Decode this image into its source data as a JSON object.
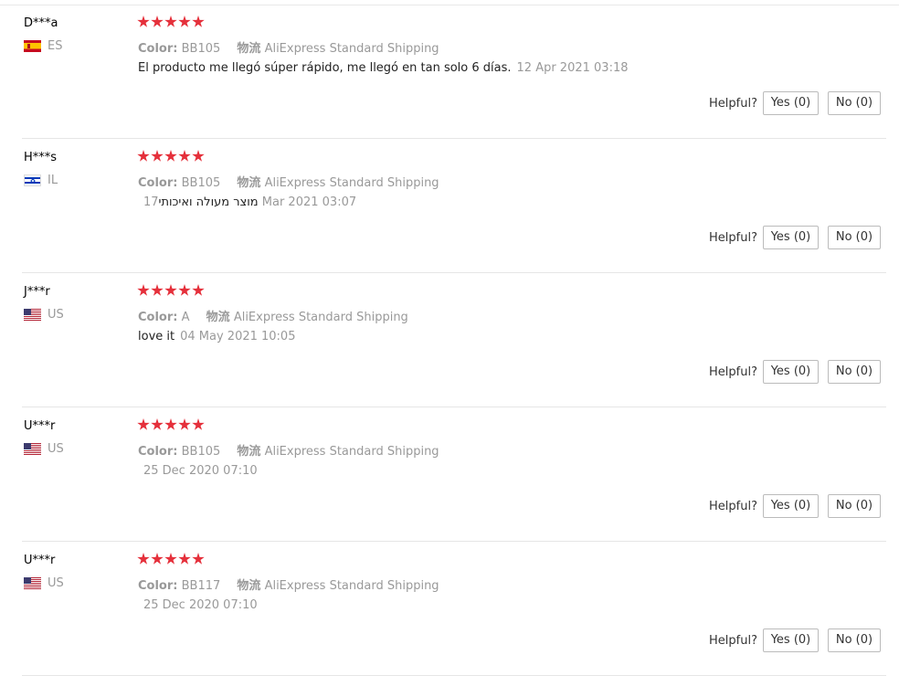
{
  "labels": {
    "color": "Color:",
    "logistics": "物流",
    "helpful": "Helpful?"
  },
  "reviews": [
    {
      "user": "D***a",
      "country": "ES",
      "color_value": "BB105",
      "shipping": "AliExpress Standard Shipping",
      "text": "El producto me llegó súper rápido, me llegó en tan solo 6 días.",
      "time": "12 Apr 2021 03:18",
      "rating": 5,
      "yes": "Yes (0)",
      "no": "No (0)"
    },
    {
      "user": "H***s",
      "country": "IL",
      "color_value": "BB105",
      "shipping": "AliExpress Standard Shipping",
      "text": "מוצר מעולה ואיכותי",
      "time": "17 Mar 2021 03:07",
      "rating": 5,
      "yes": "Yes (0)",
      "no": "No (0)"
    },
    {
      "user": "J***r",
      "country": "US",
      "color_value": "A",
      "shipping": "AliExpress Standard Shipping",
      "text": "love it",
      "time": "04 May 2021 10:05",
      "rating": 5,
      "yes": "Yes (0)",
      "no": "No (0)"
    },
    {
      "user": "U***r",
      "country": "US",
      "color_value": "BB105",
      "shipping": "AliExpress Standard Shipping",
      "text": "",
      "time": "25 Dec 2020 07:10",
      "rating": 5,
      "yes": "Yes (0)",
      "no": "No (0)"
    },
    {
      "user": "U***r",
      "country": "US",
      "color_value": "BB117",
      "shipping": "AliExpress Standard Shipping",
      "text": "",
      "time": "25 Dec 2020 07:10",
      "rating": 5,
      "yes": "Yes (0)",
      "no": "No (0)"
    }
  ]
}
